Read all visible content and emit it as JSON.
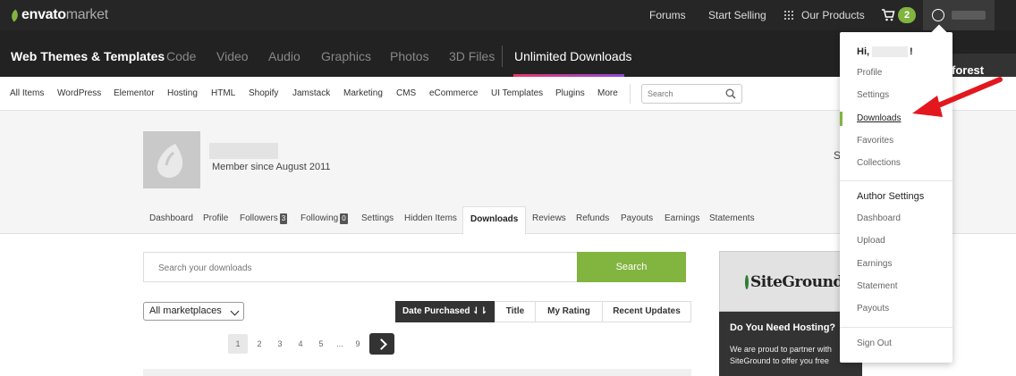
{
  "topbar": {
    "logo_envato": "envato",
    "logo_market": "market",
    "links": [
      "Forums",
      "Start Selling",
      "Our Products"
    ],
    "cart_count": "2"
  },
  "categories": {
    "items": [
      "Web Themes & Templates",
      "Code",
      "Video",
      "Audio",
      "Graphics",
      "Photos",
      "3D Files"
    ],
    "unlimited": "Unlimited Downloads",
    "side_badge": "forest"
  },
  "subnav": {
    "items": [
      "All Items",
      "WordPress",
      "Elementor",
      "Hosting",
      "HTML",
      "Shopify",
      "Jamstack",
      "Marketing",
      "CMS",
      "eCommerce",
      "UI Templates",
      "Plugins",
      "More"
    ],
    "search_placeholder": "Search"
  },
  "profile": {
    "member_since": "Member since August 2011",
    "side_letter": "S",
    "tabs": [
      "Dashboard",
      "Profile",
      "Followers",
      "Following",
      "Settings",
      "Hidden Items",
      "Downloads",
      "Reviews",
      "Refunds",
      "Payouts",
      "Earnings",
      "Statements"
    ],
    "followers_count": "3",
    "following_count": "0",
    "active_tab": "Downloads"
  },
  "downloads": {
    "search_placeholder": "Search your downloads",
    "search_button": "Search",
    "marketplace_select": "All marketplaces",
    "sort_options": [
      "Date Purchased ⇃⇂",
      "Title",
      "My Rating",
      "Recent Updates"
    ],
    "pages": [
      "1",
      "2",
      "3",
      "4",
      "5",
      "...",
      "9"
    ],
    "active_page": "1"
  },
  "ad": {
    "brand": "SiteGround",
    "title": "Do You Need Hosting?",
    "text": "We are proud to partner with SiteGround to offer you free"
  },
  "user_menu": {
    "greeting": "Hi,",
    "greeting_end": "!",
    "items": [
      "Profile",
      "Settings",
      "Downloads",
      "Favorites",
      "Collections"
    ],
    "author_heading": "Author Settings",
    "author_items": [
      "Dashboard",
      "Upload",
      "Earnings",
      "Statement",
      "Payouts"
    ],
    "sign_out": "Sign Out"
  },
  "colors": {
    "accent_green": "#82b440",
    "annotation_arrow": "#e3171e"
  }
}
